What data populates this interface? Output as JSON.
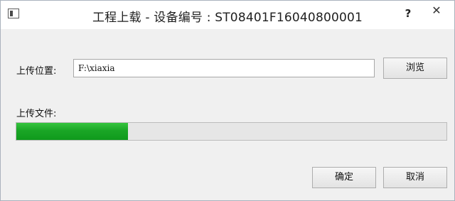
{
  "window": {
    "title": "工程上载 - 设备编号 : ST08401F16040800001",
    "help_label": "?",
    "close_label": "✕"
  },
  "upload_location": {
    "label": "上传位置:",
    "value": "F:\\xiaxia",
    "browse_label": "浏览"
  },
  "upload_file": {
    "label": "上传文件:",
    "progress": 0.26
  },
  "footer": {
    "ok_label": "确定",
    "cancel_label": "取消"
  },
  "colors": {
    "progress_green": "#1aa626"
  }
}
